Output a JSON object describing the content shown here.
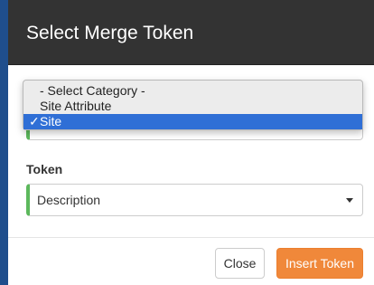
{
  "modal": {
    "title": "Select Merge Token"
  },
  "category": {
    "options": [
      {
        "label": "- Select Category -",
        "check": ""
      },
      {
        "label": "Site Attribute",
        "check": ""
      },
      {
        "label": "Site",
        "check": "✓"
      }
    ],
    "selected": "Site"
  },
  "token": {
    "label": "Token",
    "value": "Description"
  },
  "footer": {
    "close_label": "Close",
    "insert_label": "Insert Token"
  },
  "colors": {
    "header_bg": "#333333",
    "accent_green": "#5cb85c",
    "insert_orange": "#f0883a",
    "highlight_blue": "#2f6fd6"
  }
}
